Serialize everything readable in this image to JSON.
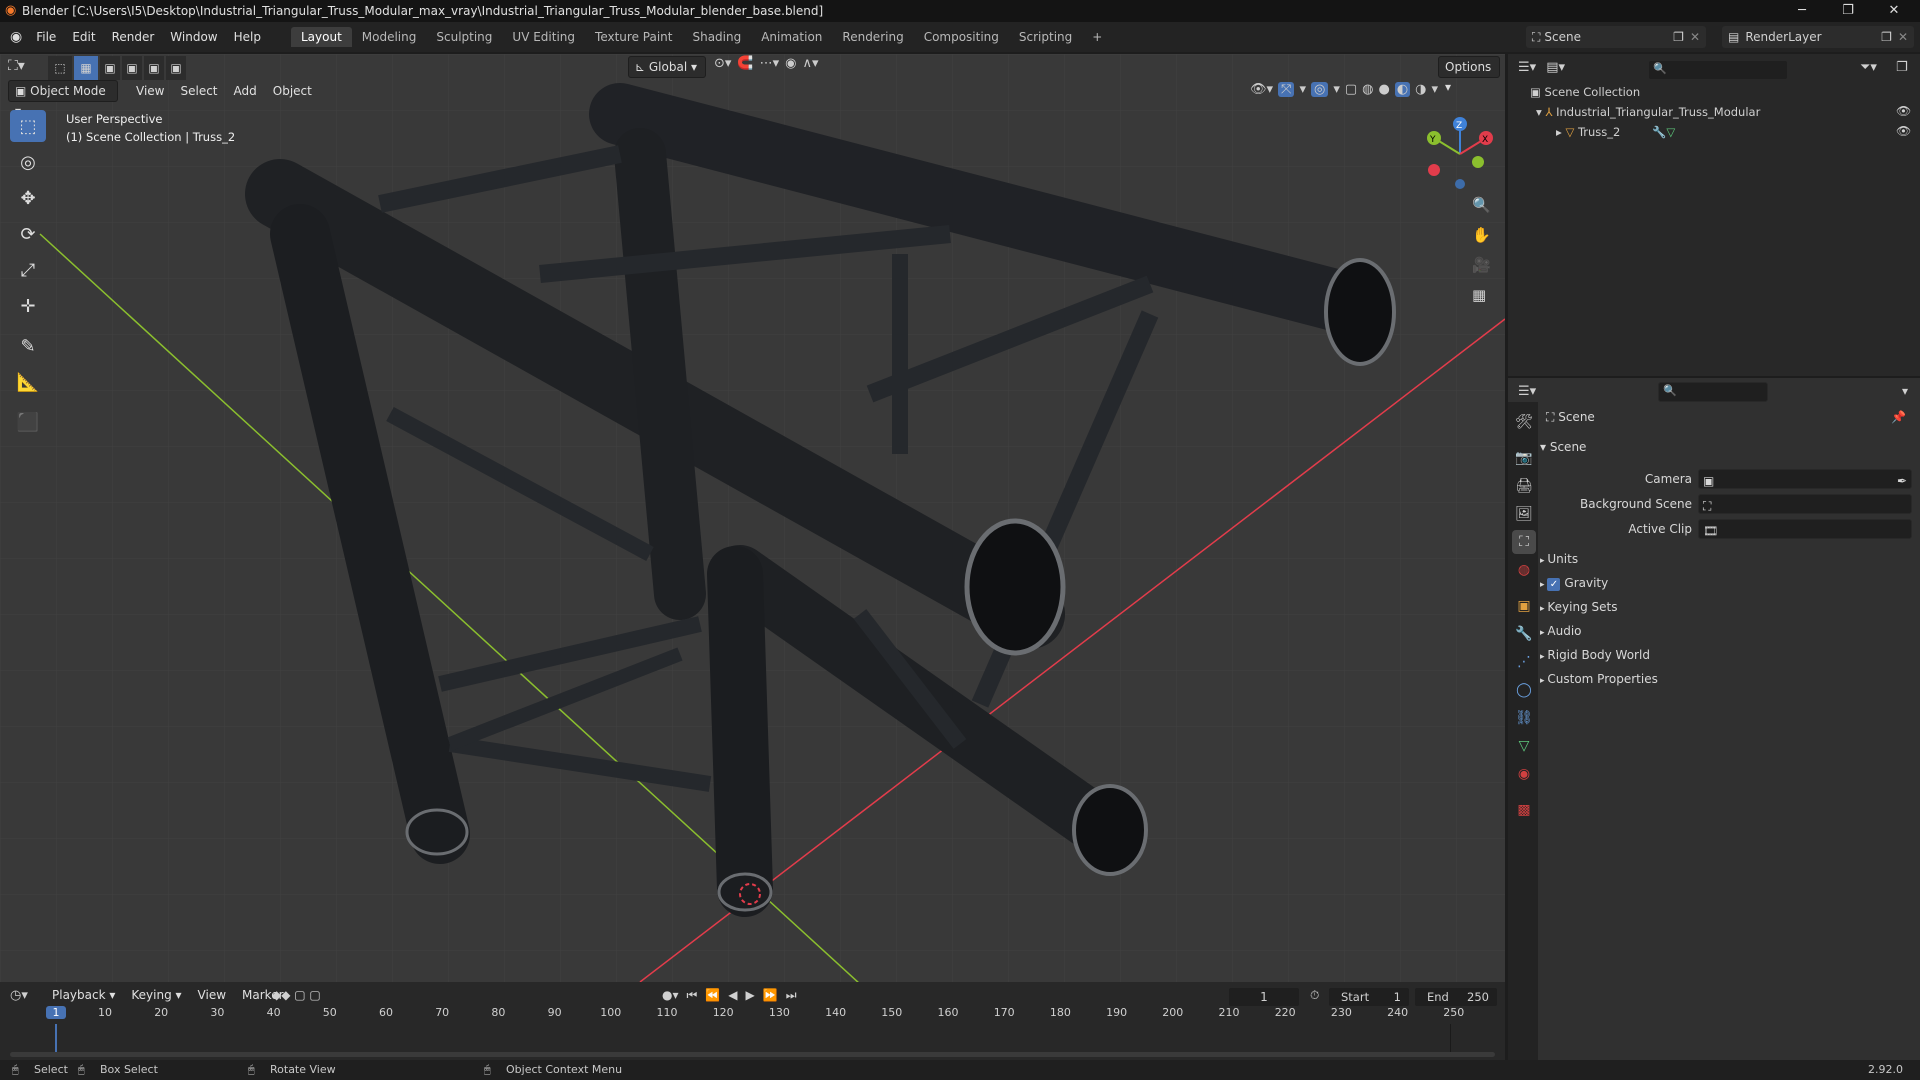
{
  "window": {
    "title": "Blender [C:\\Users\\I5\\Desktop\\Industrial_Triangular_Truss_Modular_max_vray\\Industrial_Triangular_Truss_Modular_blender_base.blend]",
    "minimize_icon": "minimize-icon",
    "restore_icon": "restore-icon",
    "close_icon": "close-icon"
  },
  "menubar": {
    "items": [
      "File",
      "Edit",
      "Render",
      "Window",
      "Help"
    ],
    "workspaces": [
      "Layout",
      "Modeling",
      "Sculpting",
      "UV Editing",
      "Texture Paint",
      "Shading",
      "Animation",
      "Rendering",
      "Compositing",
      "Scripting"
    ],
    "active_workspace": "Layout",
    "add_workspace": "+",
    "scene_name": "Scene",
    "render_layer": "RenderLayer"
  },
  "viewport": {
    "mode": "Object Mode",
    "menus": [
      "View",
      "Select",
      "Add",
      "Object"
    ],
    "transform_orientation": "Global",
    "options_label": "Options",
    "overlay_line1": "User Perspective",
    "overlay_line2": "(1) Scene Collection | Truss_2",
    "gizmo_axes": {
      "x": "X",
      "y": "Y",
      "z": "Z"
    },
    "colors": {
      "x_axis": "#e23c4b",
      "y_axis": "#8bbf2e",
      "z_axis": "#3f82d9",
      "active_tool": "#4772b3"
    }
  },
  "outliner": {
    "root": "Scene Collection",
    "collection": "Industrial_Triangular_Truss_Modular",
    "object": "Truss_2"
  },
  "properties": {
    "header": "Scene",
    "panel": "Scene",
    "fields": [
      {
        "label": "Camera",
        "value": ""
      },
      {
        "label": "Background Scene",
        "value": ""
      },
      {
        "label": "Active Clip",
        "value": ""
      }
    ],
    "subpanels": [
      "Units",
      "Gravity",
      "Keying Sets",
      "Audio",
      "Rigid Body World",
      "Custom Properties"
    ],
    "gravity_checked": true
  },
  "timeline": {
    "menus": [
      "Playback",
      "Keying",
      "View",
      "Marker"
    ],
    "current_frame": "1",
    "start_label": "Start",
    "start": "1",
    "end_label": "End",
    "end": "250",
    "ruler": [
      "1",
      "10",
      "20",
      "30",
      "40",
      "50",
      "60",
      "70",
      "80",
      "90",
      "100",
      "110",
      "120",
      "130",
      "140",
      "150",
      "160",
      "170",
      "180",
      "190",
      "200",
      "210",
      "220",
      "230",
      "240",
      "250"
    ]
  },
  "statusbar": {
    "select": "Select",
    "box_select": "Box Select",
    "rotate_view": "Rotate View",
    "context_menu": "Object Context Menu",
    "version": "2.92.0"
  }
}
